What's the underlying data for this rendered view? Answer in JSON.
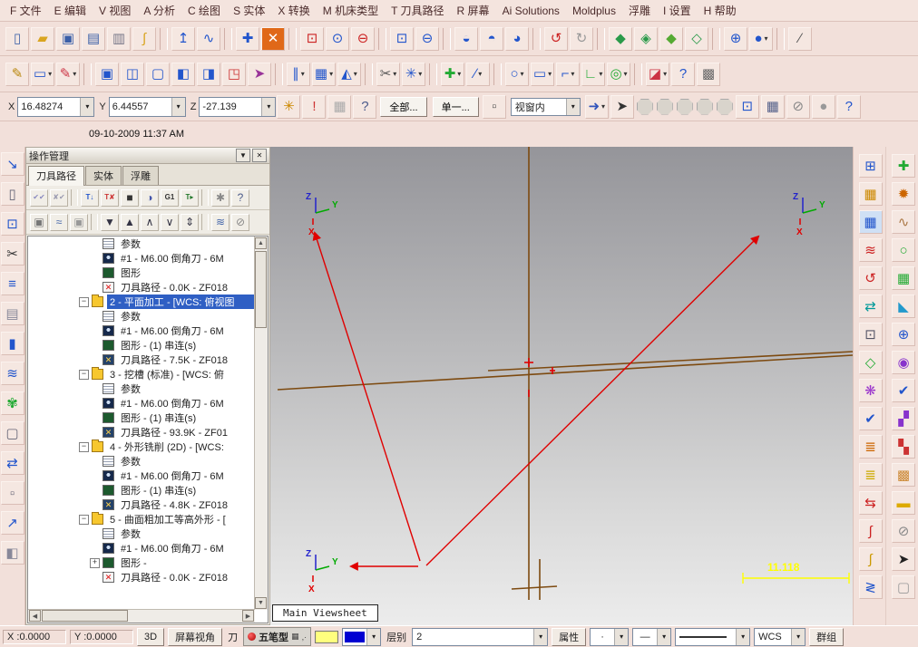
{
  "datetime": "09-10-2009 11:37 AM",
  "menubar": {
    "items": [
      {
        "id": "file",
        "label": "F 文件"
      },
      {
        "id": "edit",
        "label": "E 编辑"
      },
      {
        "id": "view",
        "label": "V 视图"
      },
      {
        "id": "analyze",
        "label": "A 分析"
      },
      {
        "id": "create",
        "label": "C 绘图"
      },
      {
        "id": "solids",
        "label": "S 实体"
      },
      {
        "id": "xform",
        "label": "X 转换"
      },
      {
        "id": "machine-type",
        "label": "M 机床类型"
      },
      {
        "id": "toolpaths",
        "label": "T 刀具路径"
      },
      {
        "id": "screen",
        "label": "R 屏幕"
      },
      {
        "id": "ai-solutions",
        "label": "Ai Solutions"
      },
      {
        "id": "moldplus",
        "label": "Moldplus"
      },
      {
        "id": "relief",
        "label": "浮雕"
      },
      {
        "id": "settings",
        "label": "I 设置"
      },
      {
        "id": "help",
        "label": "H 帮助"
      }
    ]
  },
  "toolbar_main": {
    "icons": [
      {
        "n": "new-file-icon",
        "g": "▯",
        "c": "#4466aa"
      },
      {
        "n": "open-file-icon",
        "g": "▰",
        "c": "#d9a520"
      },
      {
        "n": "save-icon",
        "g": "▣",
        "c": "#3a5fa8"
      },
      {
        "n": "print-icon",
        "g": "▤",
        "c": "#3a5fa8"
      },
      {
        "n": "screenshot-icon",
        "g": "▥",
        "c": "#777788"
      },
      {
        "n": "probe-hook-icon",
        "g": "∫",
        "c": "#d9a520"
      },
      {
        "sep": true
      },
      {
        "n": "analyze-position-icon",
        "g": "↥",
        "c": "#2255cc"
      },
      {
        "n": "analyze-dynamic-icon",
        "g": "∿",
        "c": "#2255cc"
      },
      {
        "sep": true
      },
      {
        "n": "pan-icon",
        "g": "✚",
        "c": "#2255cc"
      },
      {
        "n": "dynamic-rotate-icon",
        "g": "✕",
        "c": "#ffffff",
        "b": "#e06818"
      },
      {
        "sep": true
      },
      {
        "n": "zoom-window-icon",
        "g": "⊡",
        "c": "#cc2222"
      },
      {
        "n": "zoom-target-icon",
        "g": "⊙",
        "c": "#2255cc"
      },
      {
        "n": "zoom-in-out-icon",
        "g": "⊖",
        "c": "#cc2222"
      },
      {
        "sep": true
      },
      {
        "n": "zoom-selected-icon",
        "g": "⊡",
        "c": "#2255cc"
      },
      {
        "n": "zoom-out-icon",
        "g": "⊖",
        "c": "#2255cc"
      },
      {
        "sep": true
      },
      {
        "n": "display-option-icon-1",
        "g": "◒",
        "c": "#2255cc"
      },
      {
        "n": "display-option-icon-2",
        "g": "◓",
        "c": "#2255cc"
      },
      {
        "n": "display-option-icon-3",
        "g": "◕",
        "c": "#2255cc"
      },
      {
        "sep": true
      },
      {
        "n": "undo-icon",
        "g": "↺",
        "c": "#cc2222"
      },
      {
        "n": "redo-icon",
        "g": "↻",
        "c": "#999999"
      },
      {
        "sep": true
      },
      {
        "n": "gview-top-icon",
        "g": "◆",
        "c": "#2a9a4a"
      },
      {
        "n": "gview-front-icon",
        "g": "◈",
        "c": "#2a9a4a"
      },
      {
        "n": "gview-side-icon",
        "g": "◆",
        "c": "#55aa33"
      },
      {
        "n": "gview-iso-icon",
        "g": "◇",
        "c": "#2a9a4a"
      },
      {
        "sep": true
      },
      {
        "n": "gview-rotate-icon",
        "g": "⊕",
        "c": "#2255cc"
      },
      {
        "n": "shaded-sphere-icon",
        "g": "●",
        "c": "#2255cc",
        "dd": true
      },
      {
        "sep": true
      },
      {
        "n": "line-style-icon",
        "g": "∕",
        "c": "#555555"
      }
    ]
  },
  "toolbar_sketch": {
    "icons": [
      {
        "n": "sketch-pencil-icon",
        "g": "✎",
        "c": "#b8860b"
      },
      {
        "n": "erase-icon",
        "g": "▭",
        "c": "#2255cc",
        "dd": true
      },
      {
        "n": "restore-icon",
        "g": "✎",
        "c": "#cc3344",
        "dd": true
      },
      {
        "sep": true
      },
      {
        "n": "window-layout-icon-1",
        "g": "▣",
        "c": "#2255cc"
      },
      {
        "n": "window-layout-icon-2",
        "g": "◫",
        "c": "#2255cc"
      },
      {
        "n": "window-layout-icon-3",
        "g": "▢",
        "c": "#2255cc"
      },
      {
        "n": "window-layout-icon-4",
        "g": "◧",
        "c": "#2255cc"
      },
      {
        "n": "screen-statistics-icon",
        "g": "◨",
        "c": "#2255cc"
      },
      {
        "n": "clear-colors-icon",
        "g": "◳",
        "c": "#cc3333"
      },
      {
        "n": "regen-screen-icon",
        "g": "➤",
        "c": "#993399"
      },
      {
        "sep": true
      },
      {
        "n": "xform-translate-icon",
        "g": "∥",
        "c": "#2255cc",
        "dd": true
      },
      {
        "n": "xform-offset-icon",
        "g": "▦",
        "c": "#2255cc",
        "dd": true
      },
      {
        "n": "xform-mirror-icon",
        "g": "◭",
        "c": "#2255cc",
        "dd": true
      },
      {
        "sep": true
      },
      {
        "n": "trim-break-icon",
        "g": "✂",
        "c": "#555555",
        "dd": true
      },
      {
        "n": "modify-icon",
        "g": "✳",
        "c": "#2255cc",
        "dd": true
      },
      {
        "sep": true
      },
      {
        "n": "create-point-icon",
        "g": "✚",
        "c": "#22aa33",
        "dd": true
      },
      {
        "n": "create-line-icon",
        "g": "∕",
        "c": "#2255cc",
        "dd": true
      },
      {
        "sep": true
      },
      {
        "n": "create-arc-icon",
        "g": "○",
        "c": "#2255cc",
        "dd": true
      },
      {
        "n": "create-rect-icon",
        "g": "▭",
        "c": "#2255cc",
        "dd": true
      },
      {
        "n": "create-fillet-icon",
        "g": "⌐",
        "c": "#2255cc",
        "dd": true
      },
      {
        "n": "create-polyline-icon",
        "g": "∟",
        "c": "#22aa33",
        "dd": true
      },
      {
        "n": "create-cylinder-icon",
        "g": "◎",
        "c": "#22aa33",
        "dd": true
      },
      {
        "sep": true
      },
      {
        "n": "solids-menu-icon",
        "g": "◪",
        "c": "#cc3344",
        "dd": true
      },
      {
        "n": "help-icon",
        "g": "?",
        "c": "#2255cc"
      },
      {
        "n": "gridpoint-icon",
        "g": "▩",
        "c": "#666666"
      }
    ]
  },
  "ribbon": {
    "x_label": "X",
    "x_value": "16.48274",
    "y_label": "Y",
    "y_value": "6.44557",
    "z_label": "Z",
    "z_value": "-27.139",
    "all_button": "全部...",
    "single_button": "单一...",
    "view_dropdown": "视窗内",
    "icons_1": [
      {
        "n": "fastpoint-icon",
        "g": "✳",
        "c": "#cc8800"
      },
      {
        "n": "apply-point-icon",
        "g": "!",
        "c": "#cc3333"
      },
      {
        "n": "grid-disabled-icon",
        "g": "▦",
        "c": "#aaaaaa"
      },
      {
        "n": "autocursor-help-icon",
        "g": "?",
        "c": "#4a5a8a"
      }
    ],
    "icons_2": [
      {
        "n": "select-window-mode-icon",
        "g": "▫",
        "c": "#555555"
      }
    ],
    "icons_3": [
      {
        "n": "prompt-arrow-icon",
        "g": "➜",
        "c": "#3355bb",
        "dd": true
      },
      {
        "n": "select-pointer-icon",
        "g": "➤",
        "c": "#333333"
      },
      {
        "n": "snap-toggle-icon-1",
        "oct": true
      },
      {
        "n": "snap-toggle-icon-2",
        "oct": true
      },
      {
        "n": "snap-toggle-icon-3",
        "oct": true
      },
      {
        "n": "snap-toggle-icon-4",
        "oct": true
      },
      {
        "n": "snap-toggle-icon-5",
        "oct": true
      },
      {
        "n": "window-select-icon",
        "g": "⊡",
        "c": "#2255cc"
      },
      {
        "n": "polygon-select-icon",
        "g": "▦",
        "c": "#55618a"
      },
      {
        "n": "disable-selection-icon",
        "g": "⊘",
        "c": "#888888"
      },
      {
        "n": "snap-sphere-icon",
        "g": "●",
        "c": "#999999"
      },
      {
        "n": "selection-help-icon",
        "g": "?",
        "c": "#2255cc"
      }
    ]
  },
  "operations_manager": {
    "title": "操作管理",
    "tabs": [
      {
        "id": "toolpaths",
        "label": "刀具路径",
        "active": true
      },
      {
        "id": "solids",
        "label": "实体",
        "active": false
      },
      {
        "id": "relief",
        "label": "浮雕",
        "active": false
      }
    ],
    "toolbar_row1": [
      {
        "n": "select-all-operations-icon",
        "g": "✔✔",
        "c": "#8a8ac0"
      },
      {
        "n": "select-dirty-operations-icon",
        "g": "✘✔",
        "c": "#9a9ab0"
      },
      {
        "sep": true
      },
      {
        "n": "regenerate-selected-icon",
        "g": "T↓",
        "c": "#2255cc"
      },
      {
        "n": "regenerate-dirty-icon",
        "g": "T✘",
        "c": "#cc3333"
      },
      {
        "n": "backplot-icon",
        "g": "■",
        "c": "#333333"
      },
      {
        "n": "verify-icon",
        "g": "◑",
        "c": "#4455aa"
      },
      {
        "n": "post-g1-icon",
        "g": "G1",
        "c": "#333333"
      },
      {
        "n": "feed-speed-icon",
        "g": "T▸",
        "c": "#22772a"
      },
      {
        "sep": true
      },
      {
        "n": "ops-options-icon",
        "g": "✱",
        "c": "#888888"
      },
      {
        "n": "ops-help-icon",
        "g": "?",
        "c": "#4a5a8a"
      }
    ],
    "toolbar_row2": [
      {
        "n": "lock-selected-icon",
        "g": "▣",
        "c": "#777777"
      },
      {
        "n": "toggle-display-icon",
        "g": "≈",
        "c": "#4466aa"
      },
      {
        "n": "lock-all-icon",
        "g": "▣",
        "c": "#999999"
      },
      {
        "sep": true
      },
      {
        "n": "move-insert-down-icon",
        "g": "▼",
        "c": "#333344"
      },
      {
        "n": "move-insert-up-icon",
        "g": "▲",
        "c": "#333344"
      },
      {
        "n": "scroll-insert-up-icon",
        "g": "∧",
        "c": "#333344"
      },
      {
        "n": "scroll-insert-down-icon",
        "g": "∨",
        "c": "#333344"
      },
      {
        "n": "insert-position-icon",
        "g": "⇕",
        "c": "#333344"
      },
      {
        "sep": true
      },
      {
        "n": "toolpath-display-icon",
        "g": "≋",
        "c": "#4466aa"
      },
      {
        "n": "remove-display-icon",
        "g": "⊘",
        "c": "#888888"
      }
    ],
    "tree": [
      {
        "indent": 2,
        "icon": "params",
        "label": "参数"
      },
      {
        "indent": 2,
        "icon": "tool",
        "label": "#1 - M6.00 倒角刀 - 6M"
      },
      {
        "indent": 2,
        "icon": "geometry",
        "label": "图形"
      },
      {
        "indent": 2,
        "icon": "toolpathx",
        "label": "刀具路径 - 0.0K - ZF018"
      },
      {
        "indent": 1,
        "icon": "folder",
        "label": "2 - 平面加工 - [WCS: 俯视图",
        "selected": true,
        "expander": "minus"
      },
      {
        "indent": 2,
        "icon": "params",
        "label": "参数"
      },
      {
        "indent": 2,
        "icon": "tool",
        "label": "#1 - M6.00 倒角刀 - 6M"
      },
      {
        "indent": 2,
        "icon": "geometry",
        "label": "图形 - (1) 串连(s)"
      },
      {
        "indent": 2,
        "icon": "toolpath",
        "label": "刀具路径 - 7.5K - ZF018"
      },
      {
        "indent": 1,
        "icon": "folder",
        "label": "3 - 挖槽 (标准) - [WCS: 俯",
        "expander": "minus"
      },
      {
        "indent": 2,
        "icon": "params",
        "label": "参数"
      },
      {
        "indent": 2,
        "icon": "tool",
        "label": "#1 - M6.00 倒角刀 - 6M"
      },
      {
        "indent": 2,
        "icon": "geometry",
        "label": "图形 - (1) 串连(s)"
      },
      {
        "indent": 2,
        "icon": "toolpath",
        "label": "刀具路径 - 93.9K - ZF01"
      },
      {
        "indent": 1,
        "icon": "folder",
        "label": "4 - 外形铣削 (2D) - [WCS:",
        "expander": "minus"
      },
      {
        "indent": 2,
        "icon": "params",
        "label": "参数"
      },
      {
        "indent": 2,
        "icon": "tool",
        "label": "#1 - M6.00 倒角刀 - 6M"
      },
      {
        "indent": 2,
        "icon": "geometry",
        "label": "图形 - (1) 串连(s)"
      },
      {
        "indent": 2,
        "icon": "toolpath",
        "label": "刀具路径 - 4.8K - ZF018"
      },
      {
        "indent": 1,
        "icon": "folder",
        "label": "5 - 曲面粗加工等高外形 - [",
        "expander": "minus"
      },
      {
        "indent": 2,
        "icon": "params",
        "label": "参数"
      },
      {
        "indent": 2,
        "icon": "tool",
        "label": "#1 - M6.00 倒角刀 - 6M"
      },
      {
        "indent": 2,
        "icon": "geometry",
        "label": "图形 -",
        "expander": "plus"
      },
      {
        "indent": 2,
        "icon": "toolpathx",
        "label": "刀具路径 - 0.0K - ZF018"
      }
    ]
  },
  "left_toolbar": {
    "icons": [
      {
        "n": "left-tool-icon-1",
        "g": "↘",
        "c": "#2255cc"
      },
      {
        "n": "left-tool-icon-2",
        "g": "▯",
        "c": "#666677"
      },
      {
        "n": "left-tool-icon-3",
        "g": "⊡",
        "c": "#2255cc"
      },
      {
        "n": "left-tool-icon-4",
        "g": "✂",
        "c": "#333333"
      },
      {
        "n": "left-tool-icon-5",
        "g": "≡",
        "c": "#2255cc"
      },
      {
        "n": "left-tool-icon-6",
        "g": "▤",
        "c": "#888899"
      },
      {
        "n": "left-tool-icon-7",
        "g": "▮",
        "c": "#2255cc"
      },
      {
        "n": "left-tool-icon-8",
        "g": "≋",
        "c": "#2255cc"
      },
      {
        "n": "left-tool-icon-9",
        "g": "✾",
        "c": "#22aa33"
      },
      {
        "n": "left-tool-icon-10",
        "g": "▢",
        "c": "#666677"
      },
      {
        "n": "left-tool-icon-11",
        "g": "⇄",
        "c": "#2255cc"
      },
      {
        "n": "left-tool-icon-12",
        "g": "▫",
        "c": "#666677"
      },
      {
        "n": "left-tool-icon-13",
        "g": "↗",
        "c": "#2255cc"
      },
      {
        "n": "left-tool-icon-14",
        "g": "◧",
        "c": "#888899"
      }
    ]
  },
  "right_toolbar_col1": {
    "icons": [
      {
        "n": "viewsheet-manager-icon",
        "g": "⊞",
        "c": "#2255cc"
      },
      {
        "n": "grid-color-icon",
        "g": "▦",
        "c": "#cc8800"
      },
      {
        "n": "grid-active-icon",
        "g": "▦",
        "c": "#2255cc",
        "b": "#cfe0f5"
      },
      {
        "n": "red-wave-icon",
        "g": "≋",
        "c": "#cc2222"
      },
      {
        "n": "regen-undo-icon",
        "g": "↺",
        "c": "#cc2222"
      },
      {
        "n": "swap-views-icon",
        "g": "⇄",
        "c": "#009999"
      },
      {
        "n": "zoom-dashed-icon",
        "g": "⊡",
        "c": "#555566"
      },
      {
        "n": "wire-cube-icon",
        "g": "◇",
        "c": "#22aa33"
      },
      {
        "n": "render-flower-icon",
        "g": "❋",
        "c": "#9933cc"
      },
      {
        "n": "check-edit-icon",
        "g": "✔",
        "c": "#2255cc"
      },
      {
        "n": "layers-orange-icon",
        "g": "≣",
        "c": "#cc6600"
      },
      {
        "n": "layers-yellow-icon",
        "g": "≣",
        "c": "#ccaa00"
      },
      {
        "n": "arrows-lr-icon",
        "g": "⇆",
        "c": "#cc2222"
      },
      {
        "n": "s-curve-red-icon",
        "g": "∫",
        "c": "#cc2222"
      },
      {
        "n": "s-curve-yellow-icon",
        "g": "∫",
        "c": "#cc9900"
      },
      {
        "n": "z-depth-icon",
        "g": "≷",
        "c": "#2255cc"
      }
    ]
  },
  "right_toolbar_col2": {
    "icons": [
      {
        "n": "add-geometry-icon",
        "g": "✚",
        "c": "#22aa33"
      },
      {
        "n": "spiral-icon",
        "g": "✹",
        "c": "#cc6600"
      },
      {
        "n": "freeform-curve-icon",
        "g": "∿",
        "c": "#aa7744"
      },
      {
        "n": "green-circle-icon",
        "g": "○",
        "c": "#22aa33"
      },
      {
        "n": "green-grid-icon",
        "g": "▦",
        "c": "#22aa33"
      },
      {
        "n": "surface-triangle-icon",
        "g": "◣",
        "c": "#2299cc"
      },
      {
        "n": "globe-icon",
        "g": "⊕",
        "c": "#2255cc"
      },
      {
        "n": "shade-sphere-icon",
        "g": "◉",
        "c": "#8833cc"
      },
      {
        "n": "verify-check-icon",
        "g": "✔",
        "c": "#2255cc"
      },
      {
        "n": "squares-purple-icon",
        "g": "▞",
        "c": "#8833cc"
      },
      {
        "n": "squares-red-icon",
        "g": "▚",
        "c": "#cc3333"
      },
      {
        "n": "palette-grid-icon",
        "g": "▩",
        "c": "#cc8833"
      },
      {
        "n": "yellow-bar-icon",
        "g": "▬",
        "c": "#ddaa00"
      },
      {
        "n": "disable-icon",
        "g": "⊘",
        "c": "#888888"
      },
      {
        "n": "cursor-icon",
        "g": "➤",
        "c": "#222222"
      },
      {
        "n": "empty-box-icon",
        "g": "▢",
        "c": "#999999"
      }
    ]
  },
  "viewport": {
    "viewsheet_tab": "Main Viewsheet",
    "dimension_label": "11.118",
    "axis_labels": {
      "x": "X",
      "y": "Y",
      "z": "Z"
    }
  },
  "statusbar": {
    "x_coord": "X :0.0000",
    "y_coord": "Y :0.0000",
    "mode": "3D",
    "screen_view": "屏幕视角",
    "tool_label": "刀",
    "ime": "五笔型",
    "level_label": "层别",
    "level_value": "2",
    "attributes_label": "属性",
    "point_style": "·",
    "line_style": "—",
    "wcs_label": "WCS",
    "group_label": "群组"
  }
}
